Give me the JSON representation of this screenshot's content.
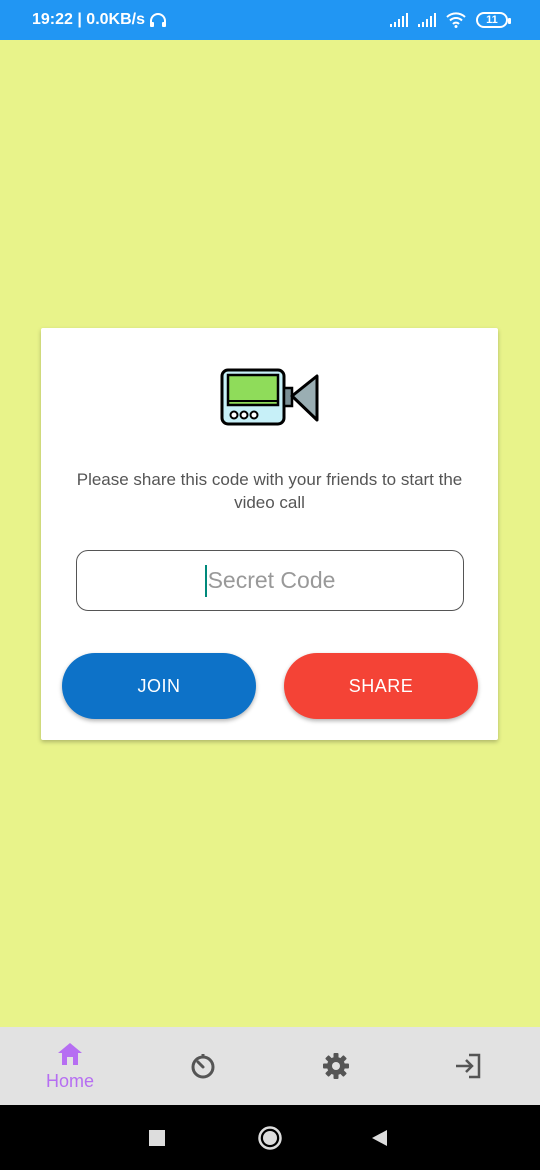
{
  "status_bar": {
    "time_network": "19:22 | 0.0KB/s",
    "battery": "11"
  },
  "card": {
    "message": "Please share this code with your friends to start the video call",
    "input_placeholder": "Secret Code",
    "join_label": "JOIN",
    "share_label": "SHARE"
  },
  "bottom_nav": {
    "home_label": "Home",
    "active_color": "#b66ef2",
    "icons": [
      "home-icon",
      "history-icon",
      "gear-icon",
      "logout-icon"
    ]
  },
  "colors": {
    "background": "#e8f38a",
    "status_bar": "#2196f3",
    "join": "#0d72c8",
    "share": "#f44336"
  }
}
